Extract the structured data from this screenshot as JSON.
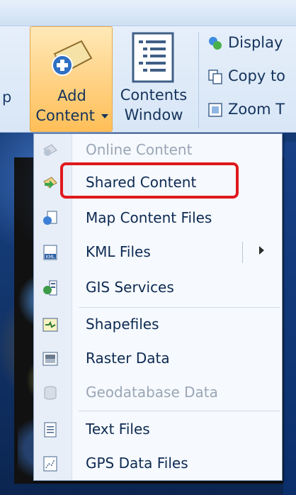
{
  "ribbon": {
    "partial_left_label": "p",
    "add_content": {
      "line1": "Add",
      "line2": "Content",
      "has_dropdown": true
    },
    "contents_window": {
      "line1": "Contents",
      "line2": "Window"
    },
    "small_buttons": [
      {
        "label": "Display",
        "icon": "display-icon"
      },
      {
        "label": "Copy to",
        "icon": "copy-icon"
      },
      {
        "label": "Zoom T",
        "icon": "zoom-icon"
      }
    ]
  },
  "menu": {
    "items": [
      {
        "label": "Online Content",
        "icon": "online-content-icon",
        "disabled": true
      },
      {
        "label": "Shared Content",
        "icon": "shared-content-icon",
        "disabled": false,
        "highlighted": true
      },
      {
        "label": "Map Content Files",
        "icon": "map-content-files-icon",
        "disabled": false
      },
      {
        "label": "KML Files",
        "icon": "kml-icon",
        "disabled": false,
        "submenu": true
      },
      {
        "label": "GIS Services",
        "icon": "gis-services-icon",
        "disabled": false
      },
      {
        "label": "Shapefiles",
        "icon": "shapefile-icon",
        "disabled": false
      },
      {
        "label": "Raster Data",
        "icon": "raster-icon",
        "disabled": false
      },
      {
        "label": "Geodatabase Data",
        "icon": "geodatabase-icon",
        "disabled": true
      },
      {
        "label": "Text Files",
        "icon": "text-file-icon",
        "disabled": false
      },
      {
        "label": "GPS Data Files",
        "icon": "gps-icon",
        "disabled": false
      }
    ]
  },
  "colors": {
    "highlight_border": "#e0191d",
    "button_active": "#ffd58b",
    "menu_text": "#0d2a52",
    "menu_disabled_text": "#9aa6b6"
  }
}
